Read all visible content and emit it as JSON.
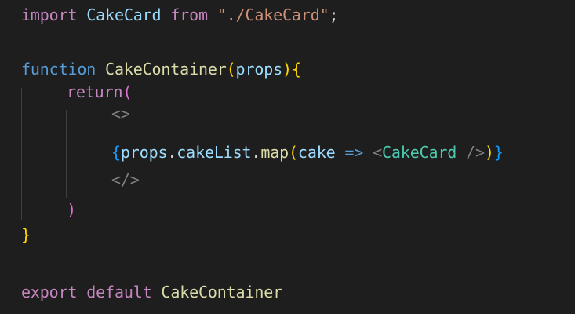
{
  "code": {
    "line1": {
      "keyword_import": "import",
      "identifier": "CakeCard",
      "keyword_from": "from",
      "path": "\"./CakeCard\"",
      "semicolon": ";"
    },
    "line3": {
      "keyword_function": "function",
      "function_name": "CakeContainer",
      "open_paren": "(",
      "param": "props",
      "close_paren": ")",
      "open_brace": "{"
    },
    "line4": {
      "keyword_return": "return",
      "open_paren": "("
    },
    "line5": {
      "fragment_open": "<>"
    },
    "line6": {
      "open_brace": "{",
      "object": "props",
      "dot1": ".",
      "property": "cakeList",
      "dot2": ".",
      "method": "map",
      "open_paren": "(",
      "arg": "cake",
      "arrow": "=>",
      "tag_open": "<",
      "component": "CakeCard",
      "tag_close": " />",
      "close_paren": ")",
      "close_brace": "}"
    },
    "line7": {
      "fragment_close": "</>"
    },
    "line8": {
      "close_paren": ")"
    },
    "line9": {
      "close_brace": "}"
    },
    "line11": {
      "keyword_export": "export",
      "keyword_default": "default",
      "identifier": "CakeContainer"
    }
  },
  "colors": {
    "background": "#1e1e1e",
    "keyword_control": "#c586c0",
    "keyword_storage": "#569cd6",
    "function": "#dcdcaa",
    "variable": "#9cdcfe",
    "string": "#ce9178",
    "component": "#4ec9b0",
    "bracket_level1": "#ffd700",
    "bracket_level2": "#da70d6",
    "bracket_level3": "#179fff",
    "punctuation_tag": "#808080"
  }
}
